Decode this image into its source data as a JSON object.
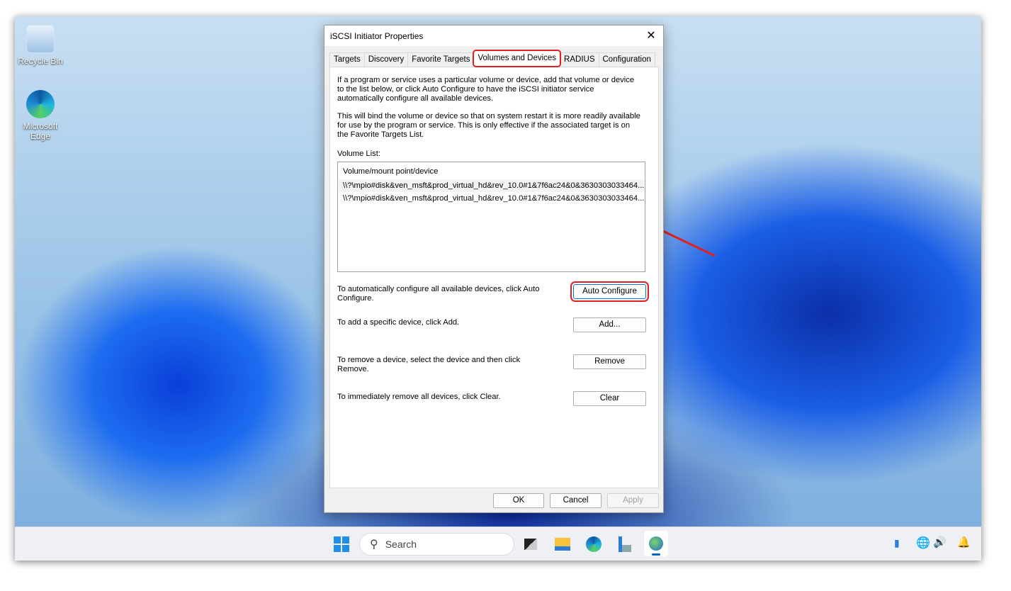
{
  "desktop": {
    "icons": [
      {
        "label": "Recycle Bin"
      },
      {
        "label": "Microsoft Edge"
      }
    ]
  },
  "dialog": {
    "title": "iSCSI Initiator Properties",
    "tabs": [
      "Targets",
      "Discovery",
      "Favorite Targets",
      "Volumes and Devices",
      "RADIUS",
      "Configuration"
    ],
    "active_tab": "Volumes and Devices",
    "intro1": "If a program or service uses a particular volume or device, add that volume or device to the list below, or click Auto Configure to have the iSCSI initiator service automatically configure all available devices.",
    "intro2": "This will bind the volume or device so that on system restart it is more readily available for use by the program or service.  This is only effective if the associated target is on the Favorite Targets List.",
    "volume_list_label": "Volume List:",
    "list_header": "Volume/mount point/device",
    "volumes": [
      "\\\\?\\mpio#disk&ven_msft&prod_virtual_hd&rev_10.0#1&7f6ac24&0&3630303033464...",
      "\\\\?\\mpio#disk&ven_msft&prod_virtual_hd&rev_10.0#1&7f6ac24&0&3630303033464..."
    ],
    "auto_text": "To automatically configure all available devices, click Auto Configure.",
    "auto_btn": "Auto Configure",
    "add_text": "To add a specific device, click Add.",
    "add_btn": "Add...",
    "remove_text": "To remove a device, select the device and then click Remove.",
    "remove_btn": "Remove",
    "clear_text": "To immediately remove all devices, click Clear.",
    "clear_btn": "Clear",
    "ok": "OK",
    "cancel": "Cancel",
    "apply": "Apply"
  },
  "taskbar": {
    "search_placeholder": "Search"
  },
  "colors": {
    "highlight": "#e02020",
    "accent": "#0078d4"
  }
}
